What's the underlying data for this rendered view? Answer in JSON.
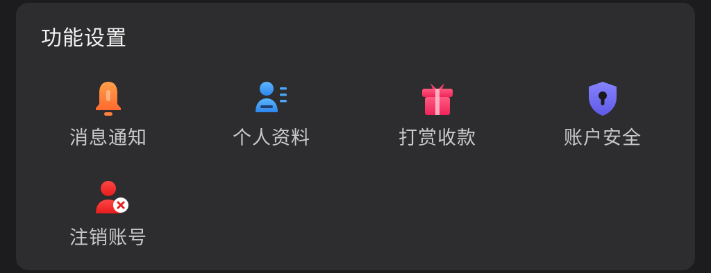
{
  "section": {
    "title": "功能设置"
  },
  "items": [
    {
      "label": "消息通知",
      "icon": "bell-icon",
      "color": "#ff7f3f"
    },
    {
      "label": "个人资料",
      "icon": "profile-card-icon",
      "color": "#3a9cf5"
    },
    {
      "label": "打赏收款",
      "icon": "gift-icon",
      "color": "#ff3f6e"
    },
    {
      "label": "账户安全",
      "icon": "shield-lock-icon",
      "color": "#6f6cf4"
    },
    {
      "label": "注销账号",
      "icon": "user-remove-icon",
      "color": "#ff2e2e"
    }
  ]
}
